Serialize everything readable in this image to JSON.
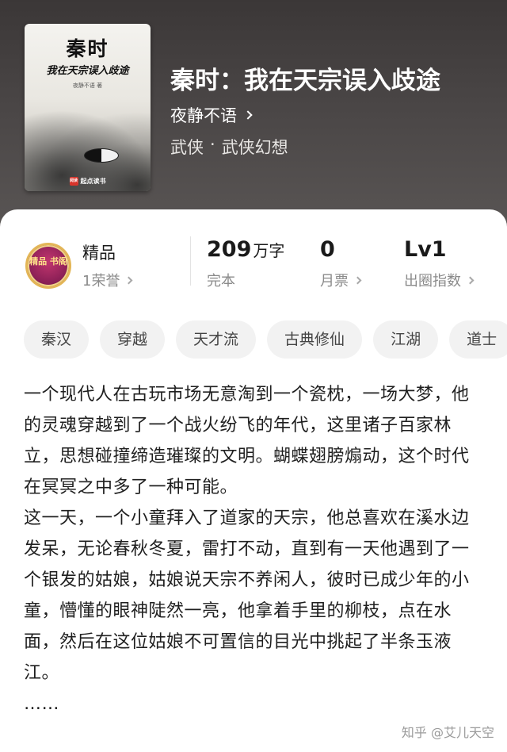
{
  "book": {
    "cover": {
      "title": "秦时",
      "subtitle": "我在天宗误入歧途",
      "author": "夜静不语 著",
      "publisher_icon": "阅读",
      "publisher": "起点读书"
    },
    "title": "秦时：我在天宗误入歧途",
    "author": "夜静不语",
    "genre_main": "武侠",
    "genre_separator": "·",
    "genre_sub": "武侠幻想"
  },
  "stats": {
    "badge_icon": "精品 书阁",
    "badge_label": "精品",
    "honor": "1荣誉",
    "word_count": "209",
    "word_unit": "万字",
    "status": "完本",
    "monthly_ticket_value": "0",
    "monthly_ticket_label": "月票",
    "level_value": "Lv1",
    "level_label": "出圈指数"
  },
  "tags": [
    "秦汉",
    "穿越",
    "天才流",
    "古典修仙",
    "江湖",
    "道士"
  ],
  "description": {
    "para1": "一个现代人在古玩市场无意淘到一个瓷枕，一场大梦，他的灵魂穿越到了一个战火纷飞的年代，这里诸子百家林立，思想碰撞缔造璀璨的文明。蝴蝶翅膀煽动，这个时代在冥冥之中多了一种可能。",
    "para2": "这一天，一个小童拜入了道家的天宗，他总喜欢在溪水边发呆，无论春秋冬夏，雷打不动，直到有一天他遇到了一个银发的姑娘，姑娘说天宗不养闲人，彼时已成少年的小童，懵懂的眼神陡然一亮，他拿着手里的柳枝，点在水面，然后在这位姑娘不可置信的目光中挑起了半条玉液江。",
    "ellipsis": "……"
  },
  "watermark": "知乎 @艾儿天空",
  "colors": {
    "header_bg": "#4a4646",
    "badge": "#8f2158"
  }
}
